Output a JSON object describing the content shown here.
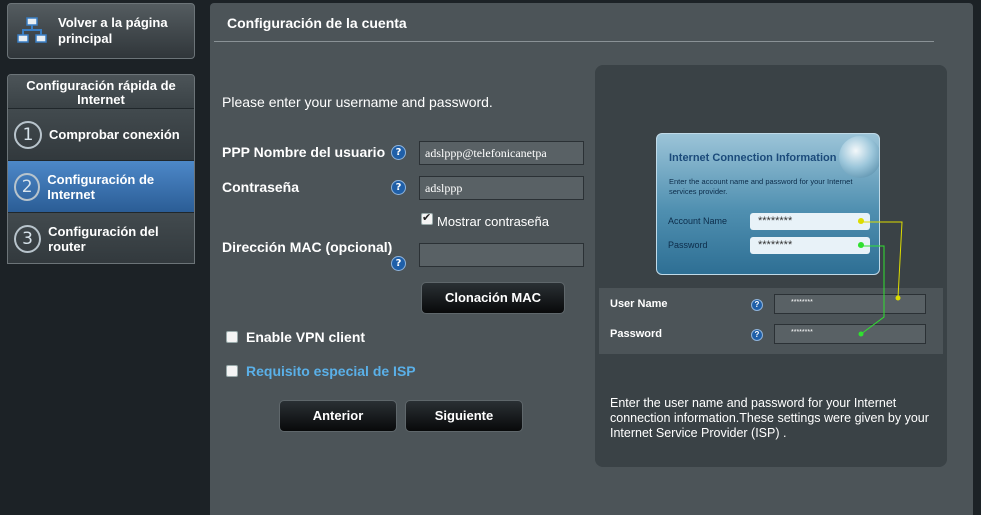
{
  "sidebar": {
    "home_label": "Volver a la página principal",
    "quick_setup_title": "Configuración rápida de Internet",
    "steps": [
      {
        "num": "1",
        "label": "Comprobar conexión",
        "active": false
      },
      {
        "num": "2",
        "label": "Configuración de Internet",
        "active": true
      },
      {
        "num": "3",
        "label": "Configuración del router",
        "active": false
      }
    ]
  },
  "main": {
    "title": "Configuración de la cuenta",
    "intro": "Please enter your username and password.",
    "ppp_username_label": "PPP Nombre del usuario",
    "ppp_username_value": "adslppp@telefonicanetpa",
    "password_label": "Contraseña",
    "password_value": "adslppp",
    "show_password_label": "Mostrar contraseña",
    "mac_label": "Dirección MAC (opcional)",
    "mac_value": "",
    "mac_clone_button": "Clonación MAC",
    "vpn_label": "Enable VPN client",
    "isp_special_label": "Requisito especial de ISP",
    "prev_button": "Anterior",
    "next_button": "Siguiente",
    "help_glyph": "?"
  },
  "info_panel": {
    "card_title": "Internet Connection Information",
    "card_desc": "Enter the account name and password for your Internet services provider.",
    "card_account_label": "Account Name",
    "card_account_value": "********",
    "card_password_label": "Password",
    "card_password_value": "********",
    "user_name_label": "User Name",
    "user_name_value": "********",
    "password_label": "Password",
    "password_value": "********",
    "description": "Enter the user name and password for your Internet connection information.These settings were given by your Internet Service Provider (ISP) ."
  },
  "colors": {
    "background": "#1c2226",
    "panel": "#4c5458",
    "active_step": "#3b74b4",
    "link": "#5ab0e8"
  },
  "icons": {
    "home": "network-icon",
    "help": "help-icon",
    "checkbox": "checkbox-icon"
  }
}
